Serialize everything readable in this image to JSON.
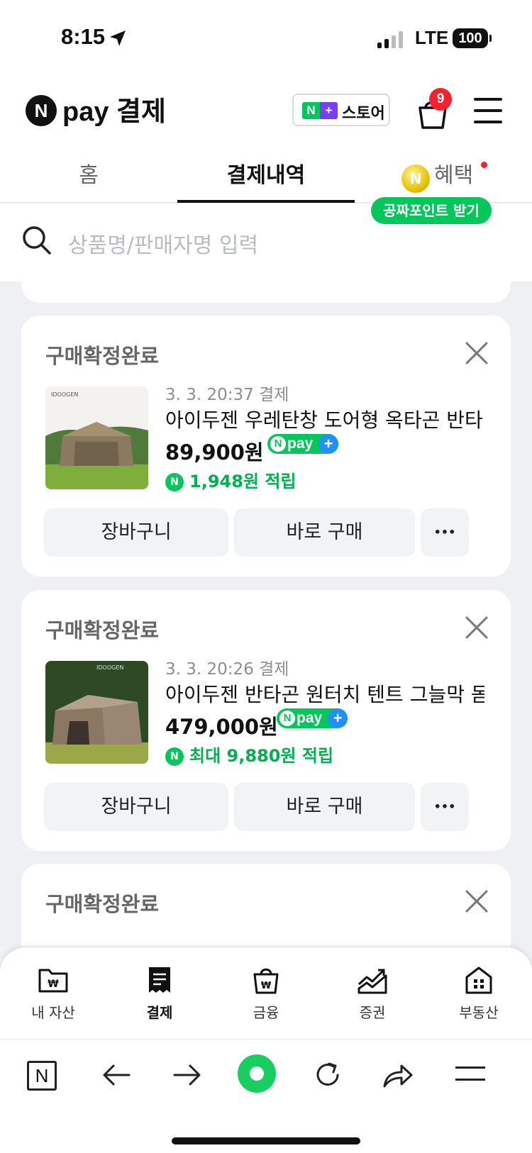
{
  "status_bar": {
    "time": "8:15",
    "network": "LTE",
    "battery": "100"
  },
  "header": {
    "logo_letter": "N",
    "logo_text": "pay 결제",
    "store_button": {
      "plus_left": "N",
      "plus_right": "+",
      "label": "스토어"
    },
    "cart_badge": "9"
  },
  "tabs": [
    {
      "label": "홈"
    },
    {
      "label": "결제내역"
    },
    {
      "label": "혜택"
    }
  ],
  "benefit_coin": "N",
  "promo_bubble": "공짜포인트 받기",
  "search": {
    "placeholder": "상품명/판매자명 입력"
  },
  "orders": [
    {
      "status": "구매확정완료",
      "date": "3. 3. 20:37 결제",
      "title": "아이두젠 우레탄창 도어형 옥타곤 반타 ...",
      "price": "89,900원",
      "npay_badge": "pay",
      "point": "1,948원 적립",
      "brand": "IDOOGEN",
      "buttons": {
        "cart": "장바구니",
        "buy": "바로 구매",
        "more": "•••"
      }
    },
    {
      "status": "구매확정완료",
      "date": "3. 3. 20:26 결제",
      "title": "아이두젠 반타곤 원터치 텐트 그늘막 돔 ...",
      "price": "479,000원",
      "npay_badge": "pay",
      "point": "최대 9,880원 적립",
      "brand": "IDOOGEN",
      "buttons": {
        "cart": "장바구니",
        "buy": "바로 구매",
        "more": "•••"
      }
    },
    {
      "status": "구매확정완료"
    }
  ],
  "bottom_nav": [
    {
      "label": "내 자산",
      "icon": "folder-won-icon"
    },
    {
      "label": "결제",
      "icon": "receipt-icon",
      "active": true
    },
    {
      "label": "금융",
      "icon": "bag-won-icon"
    },
    {
      "label": "증권",
      "icon": "stock-chart-icon"
    },
    {
      "label": "부동산",
      "icon": "building-icon"
    }
  ],
  "browser_bar": {
    "n_letter": "N"
  },
  "colors": {
    "naver_green": "#03c75a",
    "badge_red": "#f5222d",
    "npay_plus_blue": "#1e90ff",
    "background": "#eef0f3"
  }
}
